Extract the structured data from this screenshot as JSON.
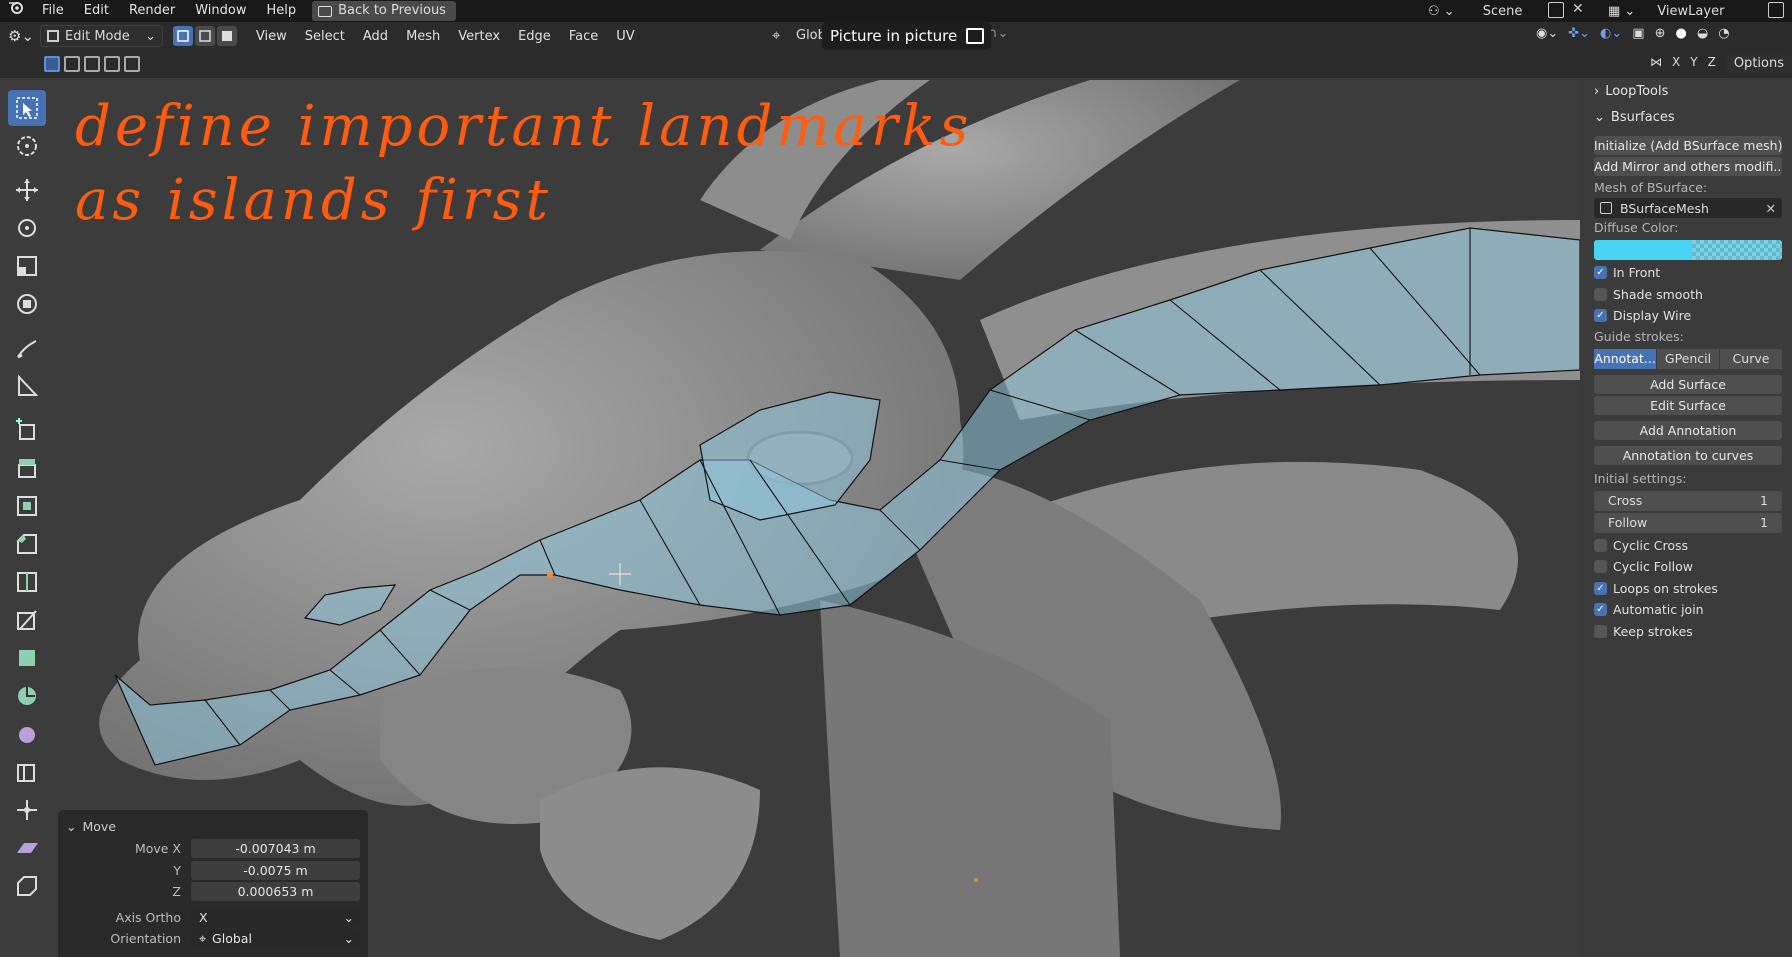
{
  "topbar": {
    "menus": [
      "File",
      "Edit",
      "Render",
      "Window",
      "Help"
    ],
    "back_label": "Back to Previous",
    "scene": "Scene",
    "view_layer": "ViewLayer"
  },
  "header": {
    "mode": "Edit Mode",
    "menus": [
      "View",
      "Select",
      "Add",
      "Mesh",
      "Vertex",
      "Edge",
      "Face",
      "UV"
    ],
    "orientation_label": "Glob",
    "options_label": "Options",
    "axes": [
      "X",
      "Y",
      "Z"
    ]
  },
  "pip": {
    "label": "Picture in picture"
  },
  "annotation": {
    "line1": "define important landmarks",
    "line2": "as islands first",
    "color": "#ff5c0f"
  },
  "npanel": {
    "looptools_label": "LoopTools",
    "bsurfaces_label": "Bsurfaces",
    "initialize_btn": "Initialize (Add BSurface mesh)",
    "add_mirror_btn": "Add Mirror and others modifi...",
    "mesh_label": "Mesh of BSurface:",
    "mesh_value": "BSurfaceMesh",
    "diffuse_label": "Diffuse Color:",
    "diffuse_color": "#46d4f2",
    "in_front": "In Front",
    "shade_smooth": "Shade smooth",
    "display_wire": "Display Wire",
    "guide_label": "Guide strokes:",
    "guide_options": [
      "Annotat...",
      "GPencil",
      "Curve"
    ],
    "add_surface": "Add Surface",
    "edit_surface": "Edit Surface",
    "add_annotation": "Add Annotation",
    "annotation_to_curves": "Annotation to curves",
    "initial_settings": "Initial settings:",
    "cross_label": "Cross",
    "cross_value": "1",
    "follow_label": "Follow",
    "follow_value": "1",
    "cyclic_cross": "Cyclic Cross",
    "cyclic_follow": "Cyclic Follow",
    "loops_on_strokes": "Loops on strokes",
    "automatic_join": "Automatic join",
    "keep_strokes": "Keep strokes"
  },
  "operator": {
    "title": "Move",
    "move_x_label": "Move X",
    "move_x": "-0.007043 m",
    "y_label": "Y",
    "y": "-0.0075 m",
    "z_label": "Z",
    "z": "0.000653 m",
    "axis_ortho_label": "Axis Ortho",
    "axis_ortho": "X",
    "orientation_label": "Orientation",
    "orientation": "Global"
  }
}
